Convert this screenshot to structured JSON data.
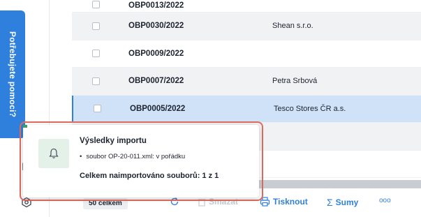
{
  "sidebar": {
    "help_label": "Potřebujete pomoci?"
  },
  "table": {
    "rows": [
      {
        "code": "OBP0013/2022",
        "company": ""
      },
      {
        "code": "OBP0030/2022",
        "company": "Shean s.r.o."
      },
      {
        "code": "OBP0009/2022",
        "company": ""
      },
      {
        "code": "OBP0007/2022",
        "company": "Petra Srbová"
      },
      {
        "code": "OBP0005/2022",
        "company": "Tesco Stores ČR a.s."
      },
      {
        "code": "",
        "company": ""
      },
      {
        "code": "",
        "company": ""
      }
    ],
    "selected_index": 4
  },
  "toolbar": {
    "count_label": "50 celkem",
    "delete_label": "Smazat",
    "print_label": "Tisknout",
    "sums_label": "Sumy",
    "more_label": "ooo"
  },
  "toast": {
    "title": "Výsledky importu",
    "bullet": "soubor OP-20-011.xml: v pořádku",
    "total": "Celkem naimportováno souborů: 1 z 1",
    "accent_color": "#3aa05a",
    "highlight_color": "#e06c5e"
  },
  "icons": {
    "toast_icon": "bell-icon",
    "sidebar_icon": "settings-hex-icon",
    "refresh_icon": "refresh-icon",
    "print_icon": "printer-icon",
    "sums_icon": "sigma-icon"
  }
}
